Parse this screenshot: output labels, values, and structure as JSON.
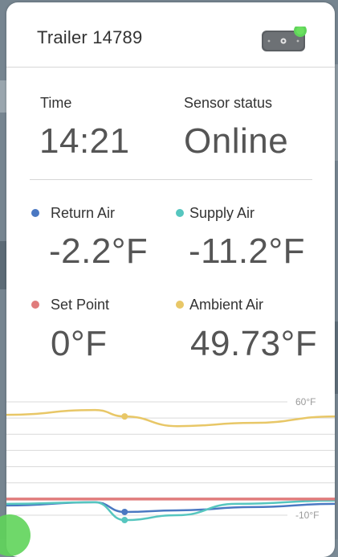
{
  "header": {
    "title": "Trailer 14789"
  },
  "status": {
    "time_label": "Time",
    "time_value": "14:21",
    "sensor_label": "Sensor status",
    "sensor_value": "Online"
  },
  "readings": {
    "return_air": {
      "label": "Return Air",
      "value": "-2.2°F",
      "color": "#4a78c2"
    },
    "supply_air": {
      "label": "Supply Air",
      "value": "-11.2°F",
      "color": "#56c6bf"
    },
    "set_point": {
      "label": "Set Point",
      "value": "0°F",
      "color": "#e07c7c"
    },
    "ambient_air": {
      "label": "Ambient Air",
      "value": "49.73°F",
      "color": "#e8c767"
    }
  },
  "device_status_color": "#5fd45a",
  "chart_data": {
    "type": "line",
    "ylim": [
      -10,
      60
    ],
    "ytick_labels": [
      "60°F",
      "-10°F"
    ],
    "series": [
      {
        "name": "Ambient Air",
        "color": "#e8c767",
        "points": [
          [
            0,
            52
          ],
          [
            0.27,
            55
          ],
          [
            0.36,
            51
          ],
          [
            0.52,
            45
          ],
          [
            0.75,
            47
          ],
          [
            1,
            51
          ]
        ]
      },
      {
        "name": "Return Air",
        "color": "#4a78c2",
        "points": [
          [
            0,
            -4
          ],
          [
            0.27,
            -2
          ],
          [
            0.36,
            -8
          ],
          [
            0.52,
            -7
          ],
          [
            0.75,
            -5
          ],
          [
            1,
            -3
          ]
        ]
      },
      {
        "name": "Supply Air",
        "color": "#56c6bf",
        "points": [
          [
            0,
            -3
          ],
          [
            0.27,
            -2
          ],
          [
            0.36,
            -13
          ],
          [
            0.52,
            -10
          ],
          [
            0.7,
            -3
          ],
          [
            1,
            -1
          ]
        ]
      },
      {
        "name": "Set Point",
        "color": "#e07c7c",
        "points": [
          [
            0,
            0
          ],
          [
            1,
            0
          ]
        ]
      }
    ],
    "highlight_x": 0.36
  }
}
